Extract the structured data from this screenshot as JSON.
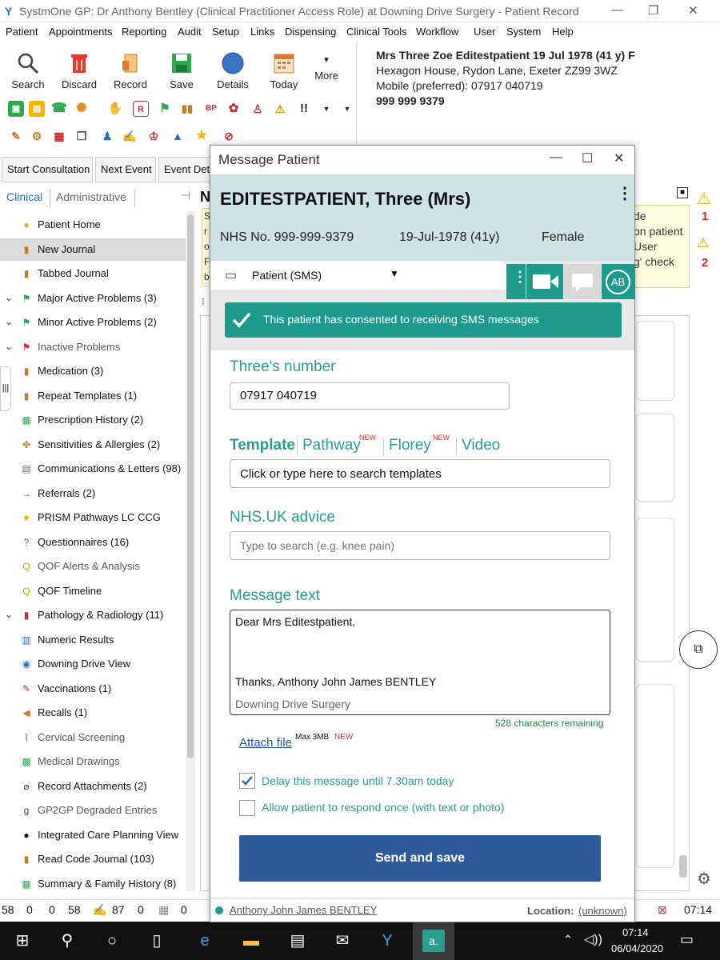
{
  "window": {
    "title": "SystmOne GP: Dr Anthony Bentley (Clinical Practitioner Access Role) at Downing Drive Surgery - Patient Record"
  },
  "menu": [
    "Patient",
    "Appointments",
    "Reporting",
    "Audit",
    "Setup",
    "Links",
    "Dispensing",
    "Clinical Tools",
    "Workflow",
    "User",
    "System",
    "Help"
  ],
  "toolbar": {
    "search": "Search",
    "discard": "Discard",
    "record": "Record",
    "save": "Save",
    "details": "Details",
    "today": "Today",
    "more": "More"
  },
  "patient_banner": {
    "line1": "Mrs Three Zoe Editestpatient 19 Jul 1978 (41 y) F",
    "line2": "Hexagon House, Rydon Lane, Exeter ZZ99 3WZ",
    "line3": "Mobile (preferred): 07917 040719",
    "line4": "999 999 9379"
  },
  "actions": {
    "start_consultation": "Start Consultation",
    "next_event": "Next Event",
    "event_details": "Event Deta"
  },
  "tabs": {
    "clinical": "Clinical",
    "administrative": "Administrative"
  },
  "tree": [
    {
      "label": "Patient Home",
      "icon": "person-icon",
      "color": "#e8a33c"
    },
    {
      "label": "New Journal",
      "icon": "journal-icon",
      "color": "#c87c2a",
      "selected": true
    },
    {
      "label": "Tabbed Journal",
      "icon": "journal-icon",
      "color": "#c87c2a"
    },
    {
      "label": "Major Active Problems (3)",
      "icon": "flag-icon",
      "color": "#2fa84f",
      "chevron": true
    },
    {
      "label": "Minor Active Problems (2)",
      "icon": "flag-icon",
      "color": "#2fa84f",
      "chevron": true
    },
    {
      "label": "Inactive Problems",
      "icon": "flag-icon",
      "color": "#e03030",
      "chevron": true,
      "grey": true
    },
    {
      "label": "Medication (3)",
      "icon": "bottle-icon",
      "color": "#c87c2a"
    },
    {
      "label": "Repeat Templates (1)",
      "icon": "bottle-icon",
      "color": "#c87c2a"
    },
    {
      "label": "Prescription History (2)",
      "icon": "grid-icon",
      "color": "#2fa84f"
    },
    {
      "label": "Sensitivities & Allergies (2)",
      "icon": "allergy-icon",
      "color": "#c87c2a"
    },
    {
      "label": "Communications & Letters (98)",
      "icon": "letter-icon",
      "color": "#666"
    },
    {
      "label": "Referrals (2)",
      "icon": "arrow-icon",
      "color": "#2c6fb5"
    },
    {
      "label": "PRISM Pathways LC CCG",
      "icon": "star-icon",
      "color": "#f2b705"
    },
    {
      "label": "Questionnaires (16)",
      "icon": "question-icon",
      "color": "#2c6fb5"
    },
    {
      "label": "QOF Alerts & Analysis",
      "icon": "qof-icon",
      "color": "#c8a000",
      "grey": true
    },
    {
      "label": "QOF Timeline",
      "icon": "qof-icon",
      "color": "#c8a000"
    },
    {
      "label": "Pathology & Radiology (11)",
      "icon": "tubes-icon",
      "color": "#c03030",
      "chevron": true
    },
    {
      "label": "Numeric Results",
      "icon": "chart-icon",
      "color": "#2c6fb5"
    },
    {
      "label": "Downing Drive View",
      "icon": "eye-icon",
      "color": "#2c6fb5"
    },
    {
      "label": "Vaccinations (1)",
      "icon": "syringe-icon",
      "color": "#c03030"
    },
    {
      "label": "Recalls (1)",
      "icon": "recall-icon",
      "color": "#c87c2a"
    },
    {
      "label": "Cervical Screening",
      "icon": "screening-icon",
      "color": "#666",
      "grey": true
    },
    {
      "label": "Medical Drawings",
      "icon": "drawing-icon",
      "color": "#2fa84f",
      "grey": true
    },
    {
      "label": "Record Attachments (2)",
      "icon": "paperclip-icon",
      "color": "#444"
    },
    {
      "label": "GP2GP Degraded Entries",
      "icon": "gp2gp-icon",
      "color": "#444",
      "grey": true
    },
    {
      "label": "Integrated Care Planning View",
      "icon": "circle-icon",
      "color": "#111"
    },
    {
      "label": "Read Code Journal (103)",
      "icon": "journal-icon",
      "color": "#c87c2a"
    },
    {
      "label": "Summary & Family History (8)",
      "icon": "summary-icon",
      "color": "#2fa84f"
    }
  ],
  "right_panel": {
    "badge1": "1",
    "badge2": "2",
    "note_lines": [
      "de",
      "on patient",
      "User",
      "g' check"
    ],
    "left_note": [
      "S",
      "r",
      "o",
      "F",
      "b"
    ]
  },
  "statusbar": {
    "v1": "58",
    "v2": "0",
    "v3": "0",
    "v4": "58",
    "v5": "87",
    "v6": "0",
    "v7": "0",
    "time": "07:14"
  },
  "taskbar": {
    "time": "07:14",
    "date": "06/04/2020"
  },
  "dialog": {
    "title": "Message Patient",
    "patient_name": "EDITESTPATIENT, Three (Mrs)",
    "nhs": "NHS No. 999-999-9379",
    "dob": "19-Jul-1978 (41y)",
    "sex": "Female",
    "channel": "Patient (SMS)",
    "avatar": "AB",
    "consent": "This patient has consented to receiving SMS messages",
    "number_label": "Three's number",
    "number_value": "07917 040719",
    "tab_template": "Template",
    "tab_pathway": "Pathway",
    "tab_florey": "Florey",
    "tab_video": "Video",
    "new_badge": "NEW",
    "template_placeholder": "Click or type here to search templates",
    "nhs_advice_label": "NHS.UK advice",
    "nhs_advice_placeholder": "Type to search (e.g. knee pain)",
    "message_label": "Message text",
    "message_line1": "Dear Mrs Editestpatient,",
    "message_line2": "Thanks, Anthony John James BENTLEY",
    "message_footer": "Downing Drive Surgery",
    "chars_remaining": "528 characters remaining",
    "attach": "Attach file",
    "attach_max": "Max 3MB",
    "delay_label": "Delay this message until 7.30am today",
    "delay_checked": true,
    "respond_label": "Allow patient to respond once (with text or photo)",
    "respond_checked": false,
    "send": "Send and save",
    "footer_user": "Anthony John James BENTLEY",
    "footer_location_label": "Location:",
    "footer_location_value": "(unknown)"
  }
}
